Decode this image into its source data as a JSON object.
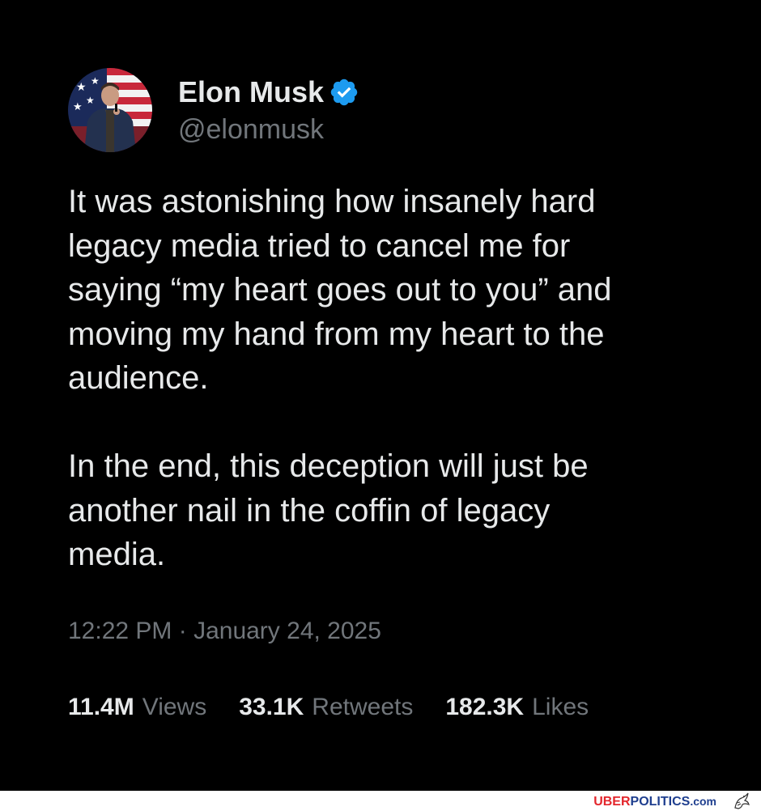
{
  "author": {
    "name": "Elon Musk",
    "handle": "@elonmusk",
    "verified": true,
    "avatar_icon": "profile-photo",
    "badge_icon": "verified-badge-icon",
    "badge_color": "#1d9bf0"
  },
  "tweet": {
    "paragraph_1": "It was astonishing how insanely hard\nlegacy media tried to cancel me for\nsaying “my heart goes out to you” and\nmoving my hand from my heart to the\naudience.",
    "paragraph_2": "In the end, this deception will just be\nanother nail in the coffin of legacy\nmedia.",
    "timestamp": "12:22 PM · January 24, 2025"
  },
  "stats": [
    {
      "value": "11.4M",
      "label": "Views"
    },
    {
      "value": "33.1K",
      "label": "Retweets"
    },
    {
      "value": "182.3K",
      "label": "Likes"
    }
  ],
  "watermark": {
    "part_1": "UBER",
    "part_2": "POLITICS",
    "part_3": ".com",
    "icon": "eagle-icon"
  },
  "colors": {
    "background": "#000000",
    "primary_text": "#e7e9ea",
    "secondary_text": "#71767b",
    "watermark_red": "#e3262c",
    "watermark_blue": "#1f3f8f"
  }
}
